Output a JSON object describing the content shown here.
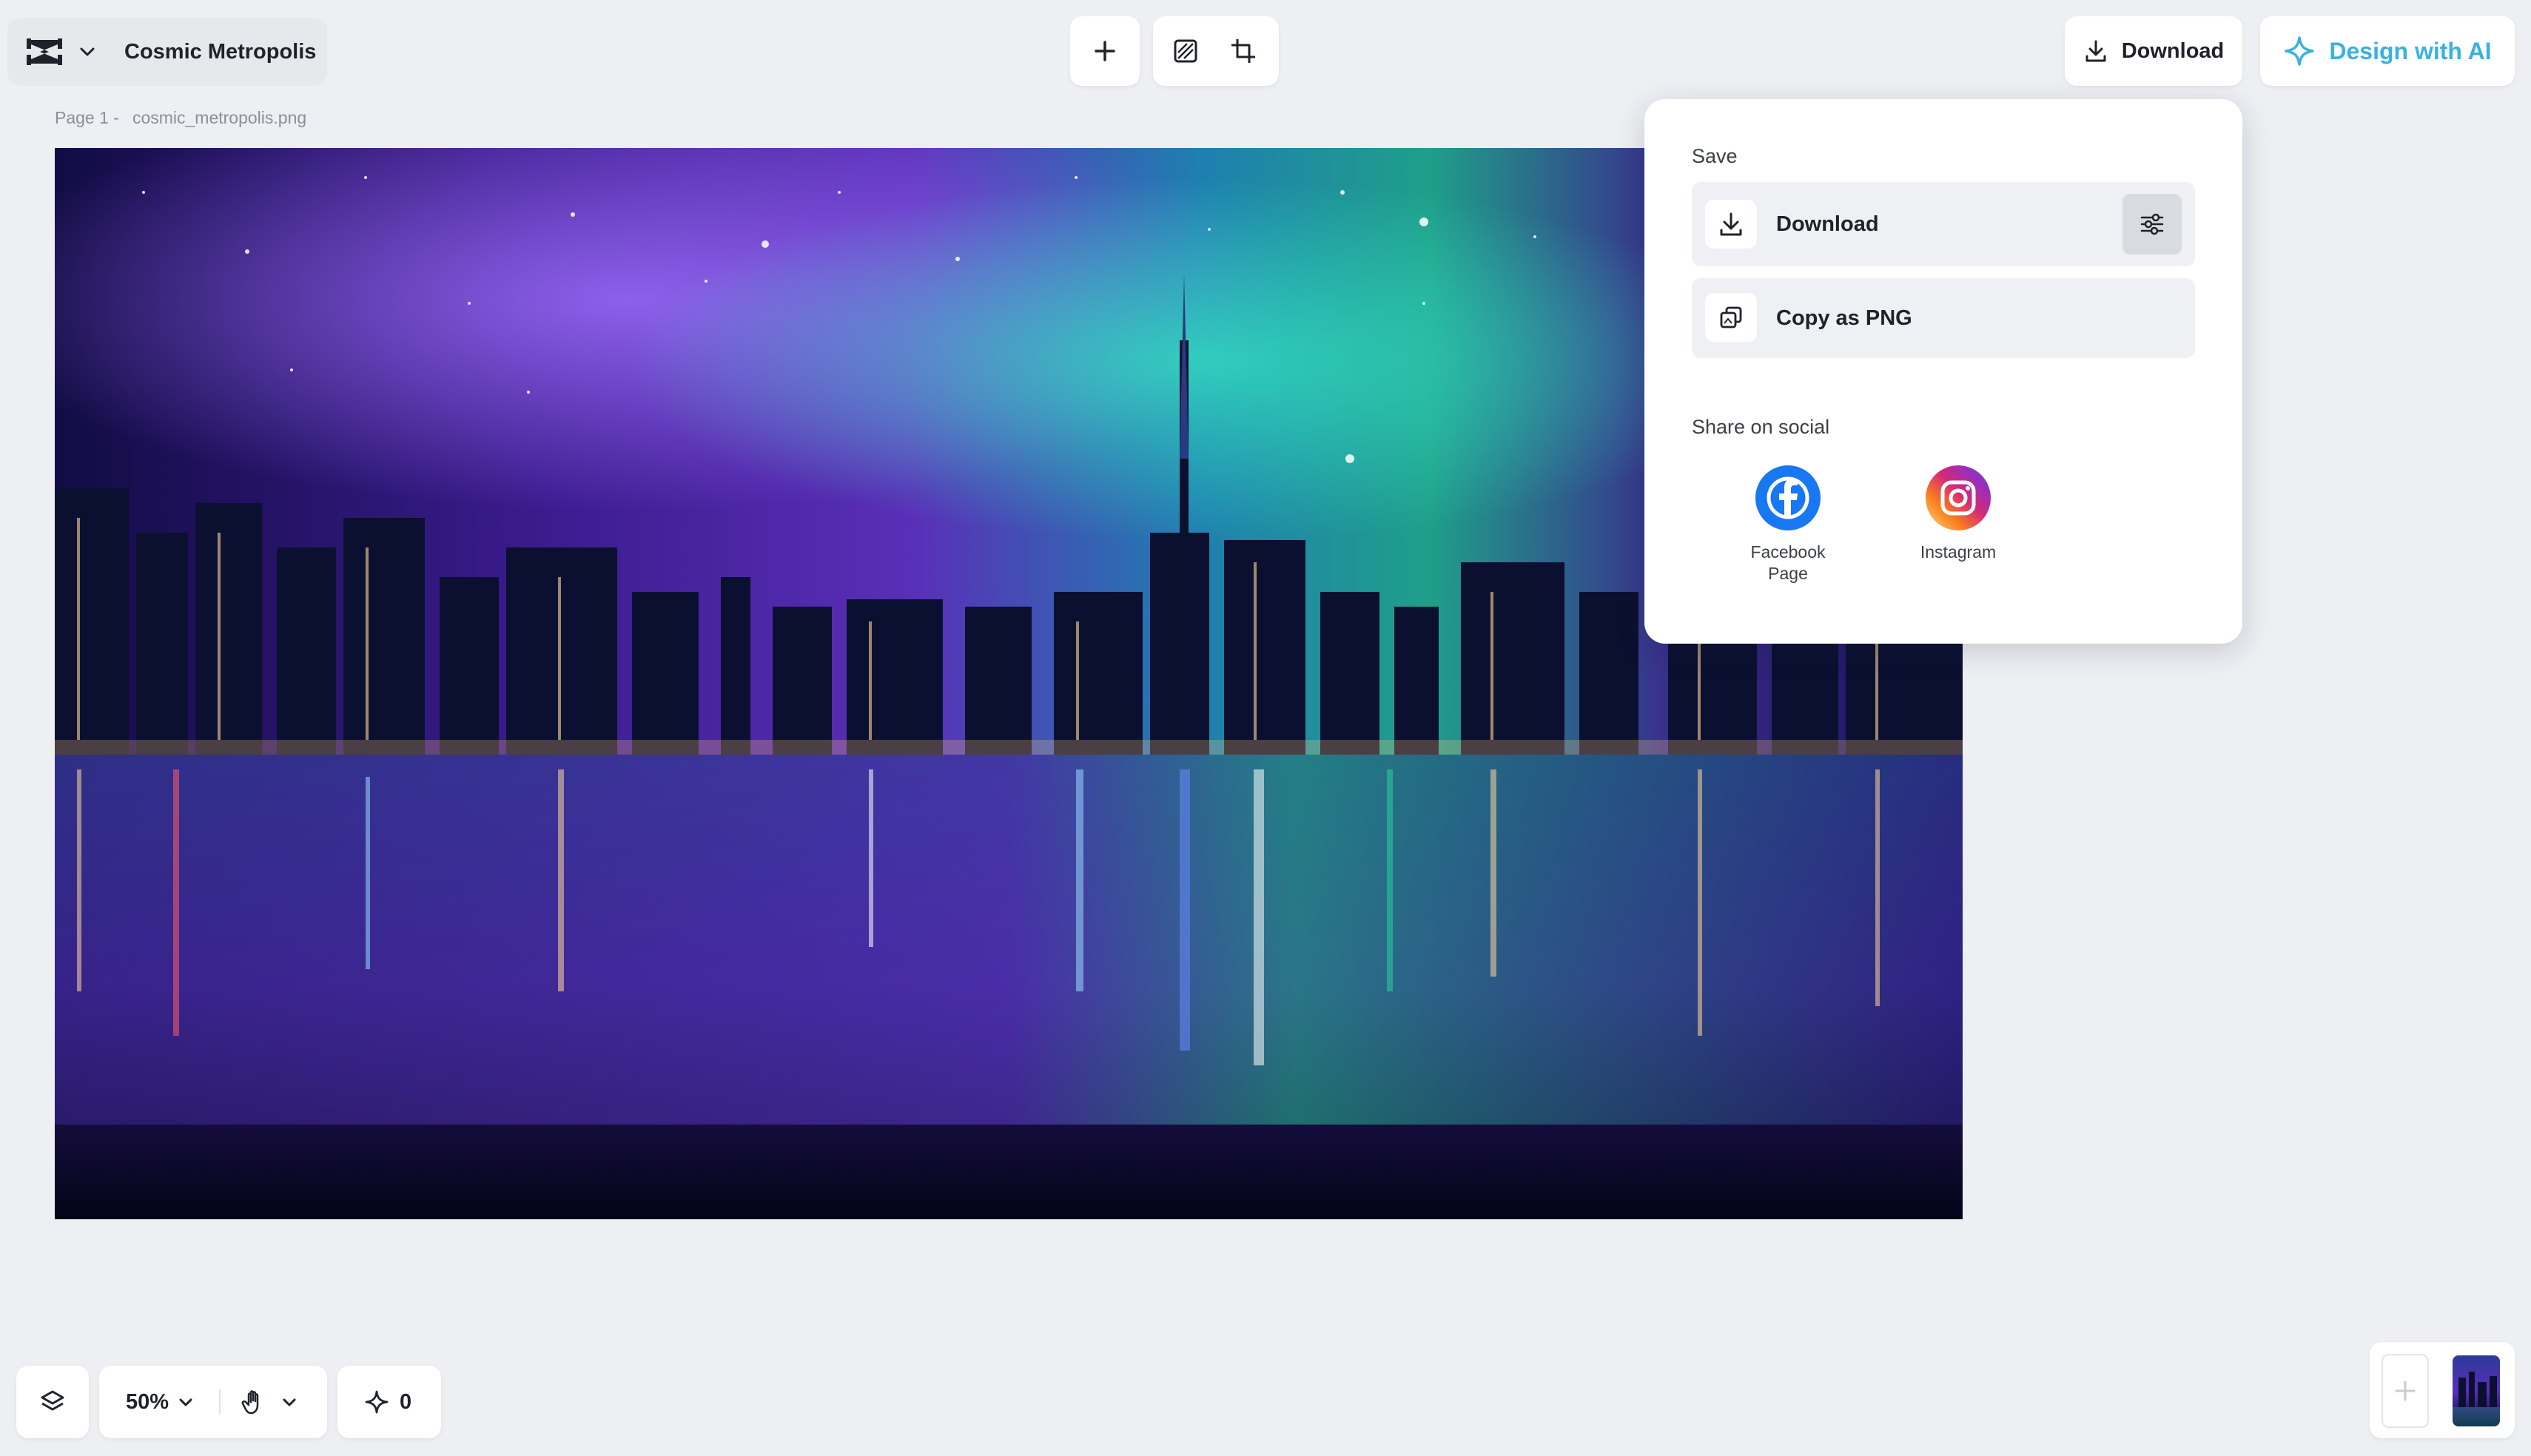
{
  "project": {
    "name": "Cosmic Metropolis"
  },
  "page_label": {
    "page": "Page 1 -",
    "filename": "cosmic_metropolis.png"
  },
  "header": {
    "download_label": "Download",
    "design_ai_label": "Design with AI",
    "accent": "#3bb0e2"
  },
  "popup": {
    "save_title": "Save",
    "download_label": "Download",
    "copy_label": "Copy as PNG",
    "share_title": "Share on social",
    "facebook_label_1": "Facebook",
    "facebook_label_2": "Page",
    "instagram_label": "Instagram",
    "facebook_color": "#1877f2"
  },
  "bottom": {
    "zoom": "50%",
    "credits": "0"
  },
  "icons": [
    "capcut-logo-icon",
    "chevron-down-icon",
    "plus-icon",
    "remove-bg-icon",
    "resize-icon",
    "download-icon",
    "sparkle-ai-icon",
    "adjust-sliders-icon",
    "copy-icon",
    "facebook-icon",
    "instagram-icon",
    "layers-icon",
    "hand-icon",
    "sparkle-icon"
  ]
}
